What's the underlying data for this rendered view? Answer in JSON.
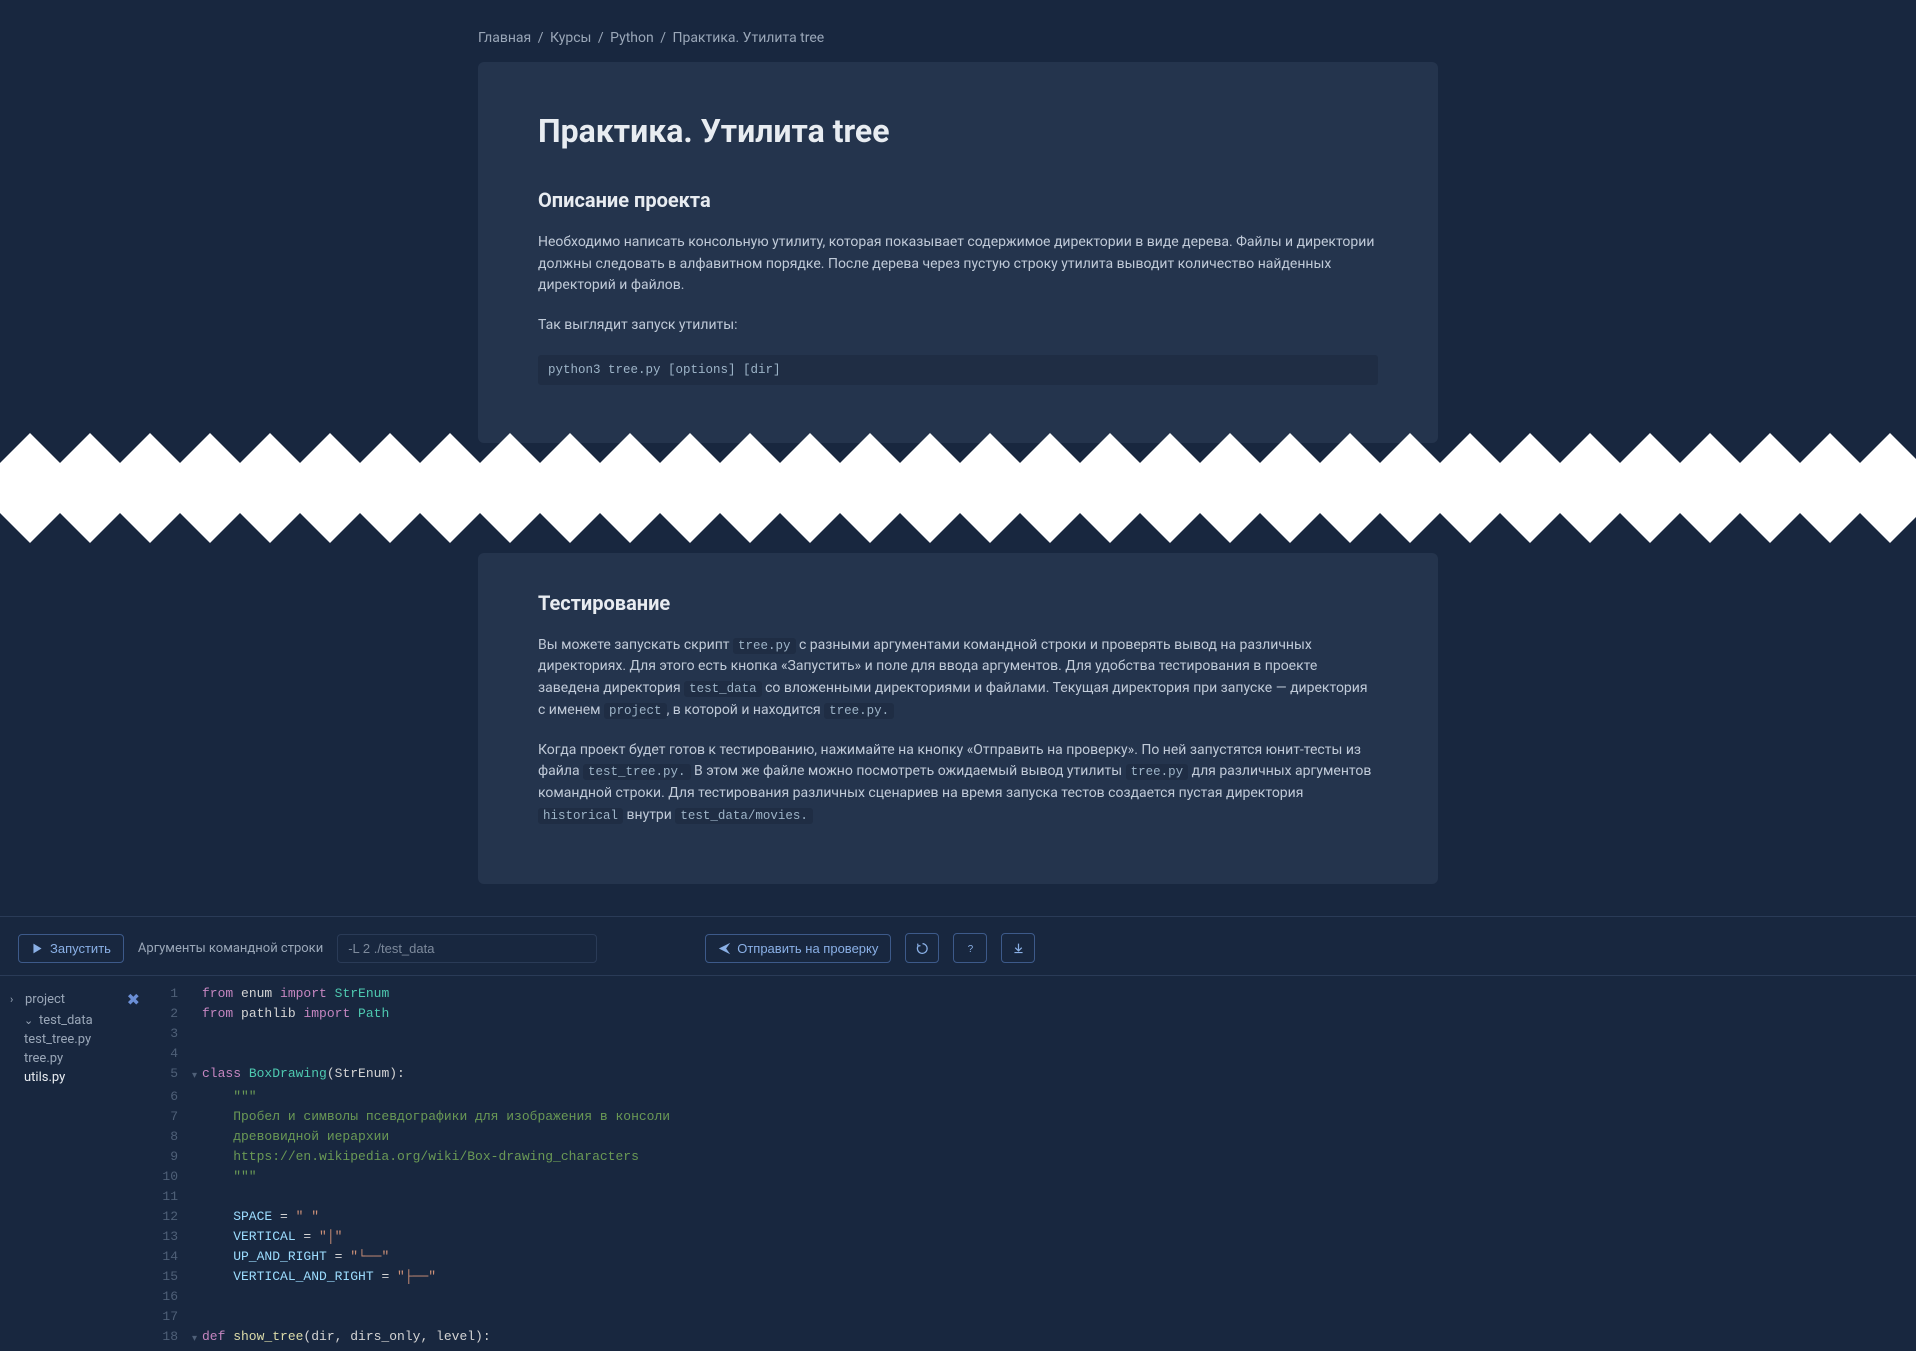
{
  "breadcrumb": {
    "home": "Главная",
    "courses": "Курсы",
    "python": "Python",
    "current": "Практика. Утилита tree"
  },
  "card": {
    "title": "Практика. Утилита tree",
    "section1_heading": "Описание проекта",
    "p1": "Необходимо написать консольную утилиту, которая показывает содержимое директории в виде дерева. Файлы и директории должны следовать в алфавитном порядке. После дерева через пустую строку утилита выводит количество найденных директорий и файлов.",
    "p2": "Так выглядит запуск утилиты:",
    "code1": "python3 tree.py [options] [dir]",
    "section2_heading": "Тестирование",
    "p3a": "Вы можете запускать скрипт ",
    "p3_code1": "tree.py",
    "p3b": " с разными аргументами командной строки и проверять вывод на различных директориях. Для этого есть кнопка «Запустить» и поле для ввода аргументов. Для удобства тестирования в проекте заведена директория ",
    "p3_code2": "test_data",
    "p3c": " со вложенными директориями и файлами. Текущая директория при запуске — директория с именем ",
    "p3_code3": "project",
    "p3d": ", в которой и находится ",
    "p3_code4": "tree.py.",
    "p4a": "Когда проект будет готов к тестированию, нажимайте на кнопку «Отправить на проверку». По ней запустятся юнит-тесты из файла ",
    "p4_code1": "test_tree.py.",
    "p4b": " В этом же файле можно посмотреть ожидаемый вывод утилиты ",
    "p4_code2": "tree.py",
    "p4c": " для различных аргументов командной строки. Для тестирования различных сценариев на время запуска тестов создается пустая директория ",
    "p4_code3": "historical",
    "p4d": " внутри ",
    "p4_code4": "test_data/movies."
  },
  "toolbar": {
    "run": "Запустить",
    "args_label": "Аргументы командной строки",
    "args_value": "-L 2 ./test_data",
    "submit": "Отправить на проверку"
  },
  "tree": {
    "root": "project",
    "folder1": "test_data",
    "file1": "test_tree.py",
    "file2": "tree.py",
    "file3": "utils.py"
  },
  "code": {
    "l1": {
      "a": "from",
      "b": " enum ",
      "c": "import",
      "d": " StrEnum"
    },
    "l2": {
      "a": "from",
      "b": " pathlib ",
      "c": "import",
      "d": " Path"
    },
    "l5": {
      "a": "class",
      "b": " BoxDrawing",
      "c": "(StrEnum):"
    },
    "l6": "    \"\"\"",
    "l7": "    Пробел и символы псевдографики для изображения в консоли",
    "l8": "    древовидной иерархии",
    "l9": "    https://en.wikipedia.org/wiki/Box-drawing_characters",
    "l10": "    \"\"\"",
    "l12": {
      "a": "    SPACE",
      "b": " = ",
      "c": "\" \""
    },
    "l13": {
      "a": "    VERTICAL",
      "b": " = ",
      "c": "\"│\""
    },
    "l14": {
      "a": "    UP_AND_RIGHT",
      "b": " = ",
      "c": "\"└──\""
    },
    "l15": {
      "a": "    VERTICAL_AND_RIGHT",
      "b": " = ",
      "c": "\"├──\""
    },
    "l18": {
      "a": "def",
      "b": " show_tree",
      "c": "(dir, dirs_only, level):"
    }
  }
}
